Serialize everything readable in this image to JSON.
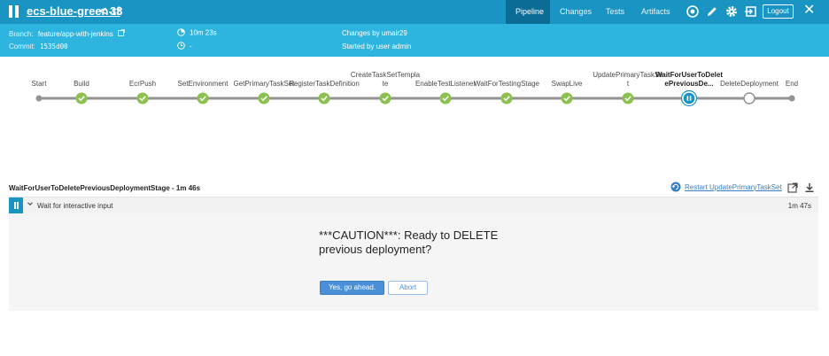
{
  "header": {
    "job_name": "ecs-blue-green-tf",
    "separator": "<",
    "run_number": "33",
    "tabs": [
      {
        "label": "Pipeline",
        "active": true
      },
      {
        "label": "Changes",
        "active": false
      },
      {
        "label": "Tests",
        "active": false
      },
      {
        "label": "Artifacts",
        "active": false
      }
    ],
    "icons": [
      "replay-icon",
      "edit-pencil-icon",
      "gear-icon",
      "exit-icon"
    ],
    "logout_label": "Logout",
    "close_label": "✕",
    "bar_color": "#1a94c2",
    "active_tab_color": "#0b6d95"
  },
  "info": {
    "branch_label": "Branch:",
    "branch_value": "feature/app-with-jenkins",
    "commit_label": "Commit:",
    "commit_value": "1535d00",
    "duration": "10m 23s",
    "finished": "-",
    "changes": "Changes by umair29",
    "started": "Started by user admin",
    "band_color": "#2db4df"
  },
  "pipeline": {
    "stages": [
      {
        "label": "Start",
        "status": "start"
      },
      {
        "label": "Build",
        "status": "success"
      },
      {
        "label": "EcrPush",
        "status": "success"
      },
      {
        "label": "SetEnvironment",
        "status": "success"
      },
      {
        "label": "GetPrimaryTaskSet",
        "status": "success"
      },
      {
        "label": "RegisterTaskDefinition",
        "status": "success"
      },
      {
        "label": "CreateTaskSetTemplate",
        "status": "success"
      },
      {
        "label": "EnableTestListener",
        "status": "success"
      },
      {
        "label": "WaitForTestingStage",
        "status": "success"
      },
      {
        "label": "SwapLive",
        "status": "success"
      },
      {
        "label": "UpdatePrimaryTaskSet",
        "status": "success"
      },
      {
        "label": "WaitForUserToDeletePreviousDe...",
        "status": "paused"
      },
      {
        "label": "DeleteDeployment",
        "status": "not-built"
      },
      {
        "label": "End",
        "status": "end"
      }
    ],
    "success_color": "#8cc04f",
    "paused_color": "#1a94c2"
  },
  "step": {
    "title": "WaitForUserToDeletePreviousDeploymentStage - 1m 46s",
    "restart_label": "Restart UpdatePrimaryTaskSet",
    "row_name": "Wait for interactive input",
    "row_duration": "1m 47s",
    "caution_line1": "***CAUTION***: Ready to DELETE",
    "caution_line2": "previous deployment?",
    "proceed_label": "Yes, go ahead.",
    "abort_label": "Abort"
  }
}
